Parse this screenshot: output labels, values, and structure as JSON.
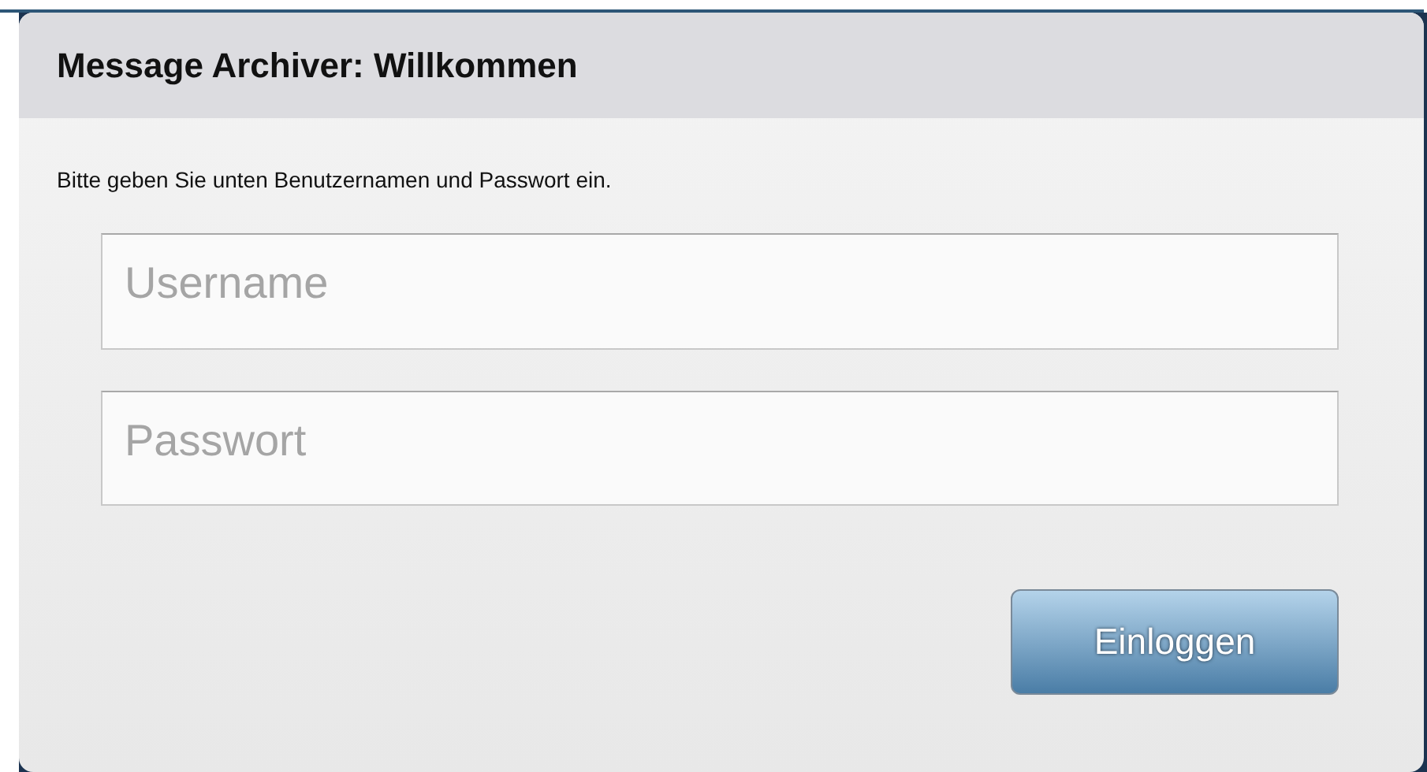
{
  "dialog": {
    "title": "Message Archiver: Willkommen",
    "instruction": "Bitte geben Sie unten Benutzernamen und Passwort ein.",
    "fields": [
      {
        "placeholder": "Username"
      },
      {
        "placeholder": "Passwort"
      }
    ],
    "button": "Einloggen"
  }
}
